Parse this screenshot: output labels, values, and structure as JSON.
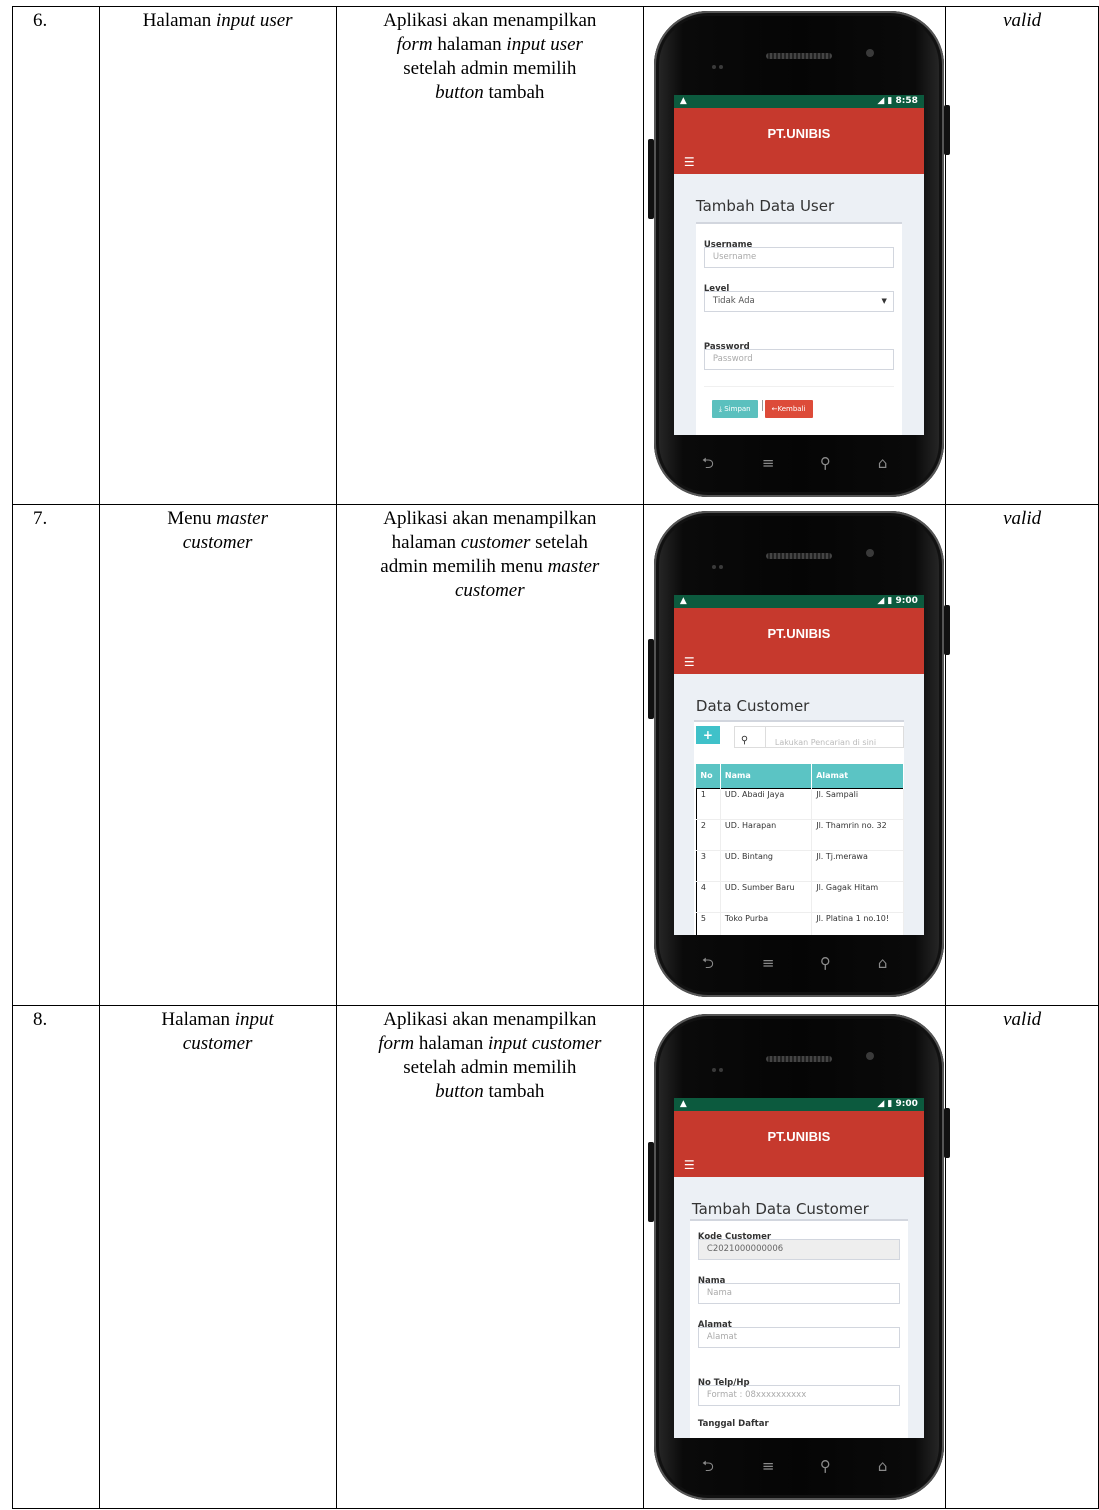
{
  "rows": [
    {
      "number": "6.",
      "scenario": {
        "pre": "Halaman ",
        "em": "input user"
      },
      "expected": [
        {
          "t": "Aplikasi akan menampilkan",
          "i": false
        },
        {
          "t": "form",
          "i": true
        },
        {
          "t": " halaman ",
          "i": false
        },
        {
          "t": "input user",
          "i": true
        },
        {
          "t": "setelah admin memilih",
          "i": false
        },
        {
          "t": "button",
          "i": true
        },
        {
          "t": " tambah",
          "i": false
        }
      ],
      "result": "valid"
    },
    {
      "number": "7.",
      "scenario_line1": {
        "pre": "Menu ",
        "em": "master"
      },
      "scenario_line2": "customer",
      "expected": {
        "l1": "Aplikasi akan menampilkan",
        "l2a": "halaman ",
        "l2b": "customer",
        "l2c": " setelah",
        "l3a": "admin memilih menu ",
        "l3b": "master",
        "l4": "customer"
      },
      "result": "valid"
    },
    {
      "number": "8.",
      "scenario_line1": {
        "pre": "Halaman ",
        "em": "input"
      },
      "scenario_line2": "customer",
      "expected": {
        "l1": "Aplikasi akan menampilkan",
        "l2a": "form",
        "l2b": " halaman ",
        "l2c": "input customer",
        "l3": "setelah admin memilih",
        "l4a": "button",
        "l4b": " tambah"
      },
      "result": "valid"
    }
  ],
  "phone1": {
    "time": "8:58",
    "brand": "PT.UNIBIS",
    "title": "Tambah Data User",
    "username_label": "Username",
    "username_placeholder": "Username",
    "level_label": "Level",
    "level_value": "Tidak Ada",
    "password_label": "Password",
    "password_placeholder": "Password",
    "save_label": "Simpan",
    "back_label": "Kembali"
  },
  "phone2": {
    "time": "9:00",
    "brand": "PT.UNIBIS",
    "title": "Data Customer",
    "search_placeholder": "Lakukan Pencarian di sini",
    "columns": [
      "No",
      "Nama",
      "Alamat"
    ],
    "customers": [
      [
        "1",
        "UD. Abadi Jaya",
        "Jl. Sampali"
      ],
      [
        "2",
        "UD. Harapan",
        "Jl. Thamrin no. 32"
      ],
      [
        "3",
        "UD. Bintang",
        "Jl. Tj.merawa"
      ],
      [
        "4",
        "UD. Sumber Baru",
        "Jl. Gagak Hitam"
      ],
      [
        "5",
        "Toko Purba",
        "Jl. Platina 1 no.10!"
      ]
    ]
  },
  "phone3": {
    "time": "9:00",
    "brand": "PT.UNIBIS",
    "title": "Tambah Data Customer",
    "kode_label": "Kode Customer",
    "kode_value": "C2021000000006",
    "nama_label": "Nama",
    "nama_placeholder": "Nama",
    "alamat_label": "Alamat",
    "alamat_placeholder": "Alamat",
    "telp_label": "No Telp/Hp",
    "telp_placeholder": "Format : 08xxxxxxxxxx",
    "tanggal_label": "Tanggal Daftar"
  }
}
